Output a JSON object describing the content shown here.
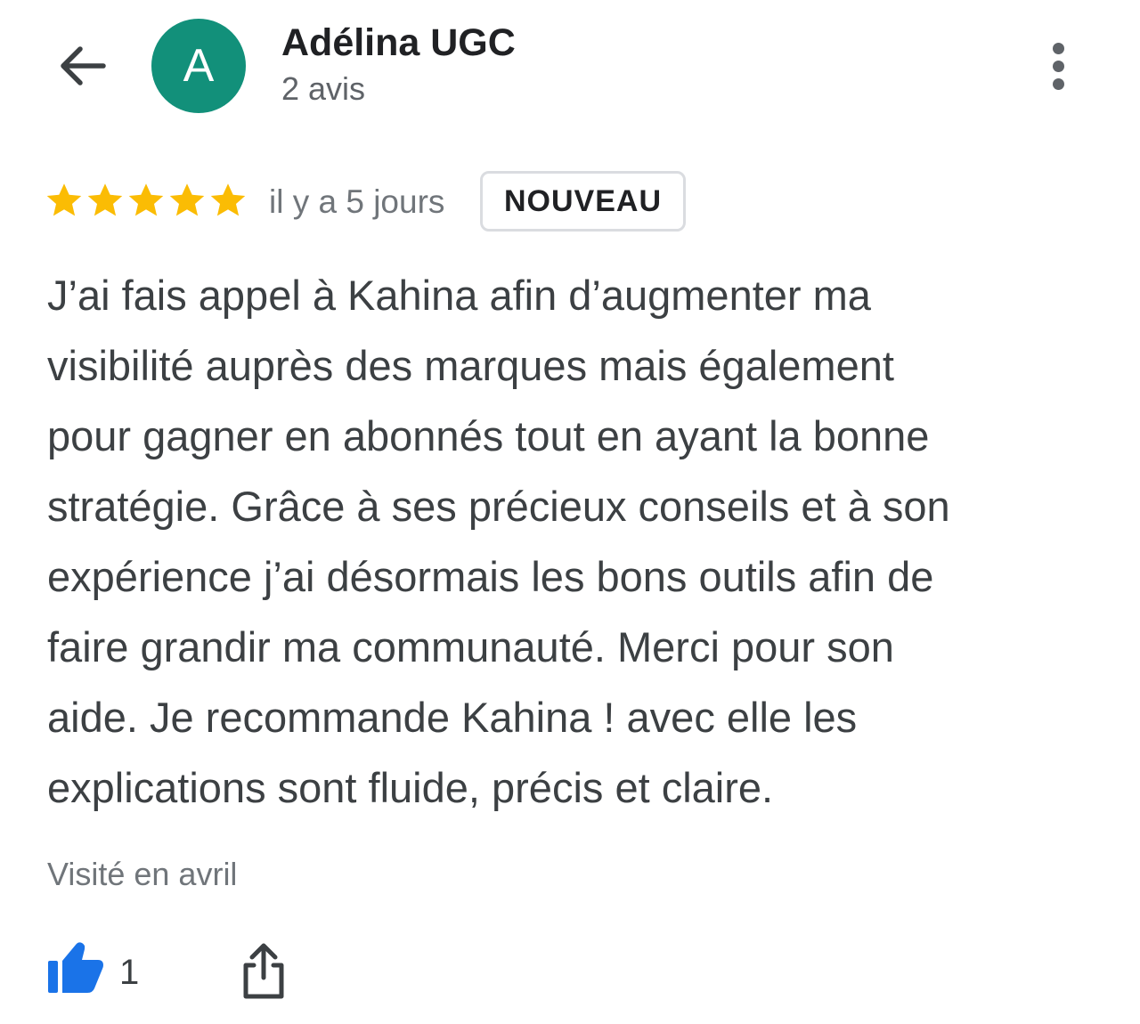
{
  "header": {
    "back_icon": "arrow-back-icon",
    "avatar_letter": "A",
    "avatar_color": "#12907a",
    "user_name": "Adélina UGC",
    "review_count": "2 avis",
    "more_icon": "more-vert-icon"
  },
  "review": {
    "rating": 5,
    "rating_max": 5,
    "star_color": "#fbbc04",
    "time_ago": "il y a 5 jours",
    "badge": "NOUVEAU",
    "text_lines": [
      "J’ai fais appel à Kahina afin d’augmenter ma",
      "visibilité auprès des marques mais également",
      "pour gagner en abonnés tout en ayant la bonne",
      "stratégie. Grâce à ses précieux conseils et à son",
      "expérience j’ai désormais les bons outils afin de",
      "faire grandir ma communauté. Merci pour son",
      "aide. Je recommande Kahina ! avec elle les",
      "explications sont fluide, précis et claire."
    ],
    "visited": "Visité en avril"
  },
  "actions": {
    "like_icon": "thumb-up-icon",
    "like_color": "#1a73e8",
    "like_count": "1",
    "share_icon": "share-icon"
  }
}
